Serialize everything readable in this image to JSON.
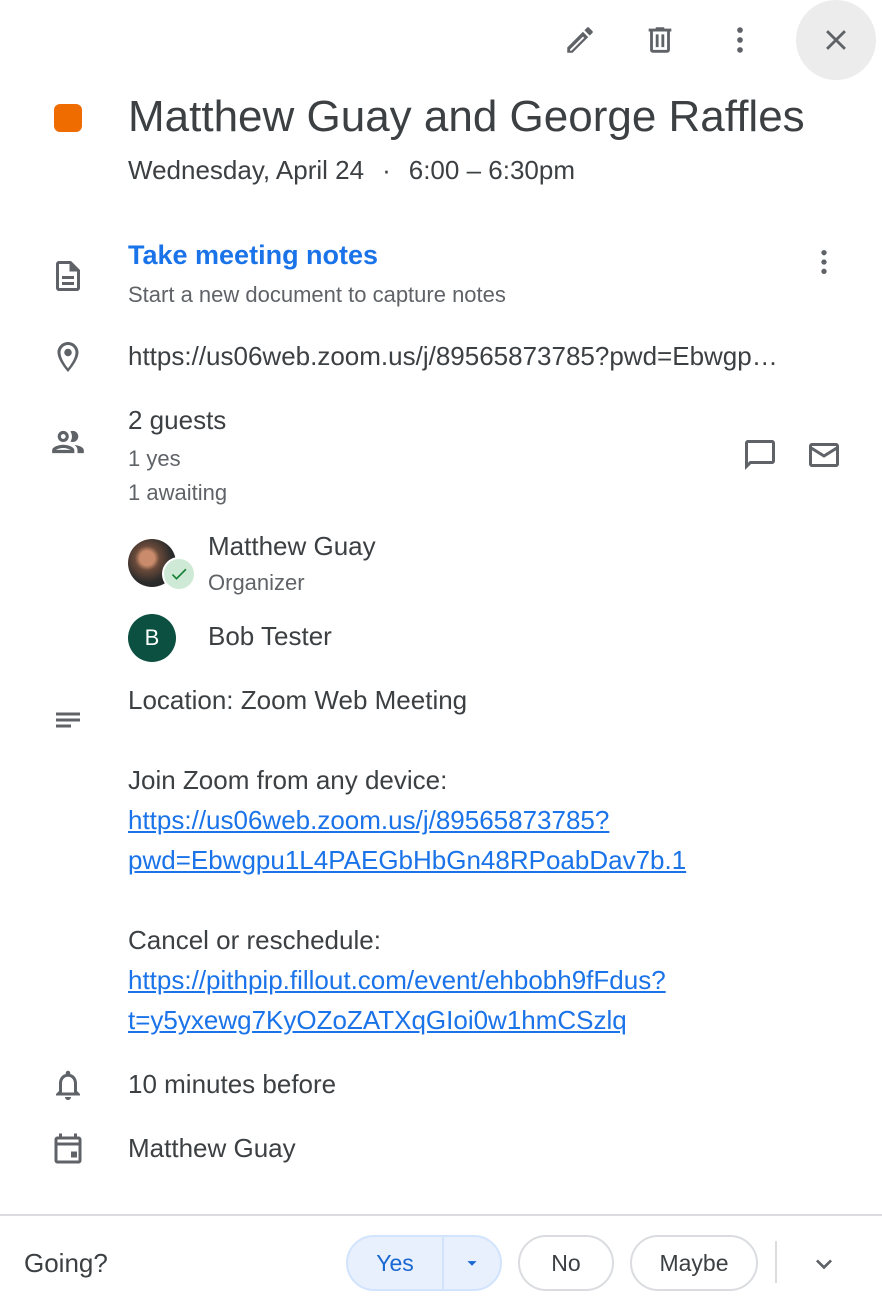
{
  "event": {
    "title": "Matthew Guay and George Raffles",
    "date": "Wednesday, April 24",
    "separator": "·",
    "time": "6:00 – 6:30pm",
    "color": "#ef6c00"
  },
  "notes": {
    "title": "Take meeting notes",
    "subtitle": "Start a new document to capture notes"
  },
  "location": {
    "url": "https://us06web.zoom.us/j/89565873785?pwd=Ebwgp…"
  },
  "guests": {
    "summary": "2 guests",
    "yes": "1 yes",
    "awaiting": "1 awaiting",
    "list": [
      {
        "name": "Matthew Guay",
        "role": "Organizer"
      },
      {
        "name": "Bob Tester",
        "initial": "B"
      }
    ]
  },
  "description": {
    "location_line": "Location: Zoom Web Meeting",
    "join_label": "Join Zoom from any device:",
    "join_link_line1": "https://us06web.zoom.us/j/89565873785?",
    "join_link_line2": "pwd=Ebwgpu1L4PAEGbHbGn48RPoabDav7b.1",
    "cancel_label": "Cancel or reschedule:",
    "cancel_link_line1": "https://pithpip.fillout.com/event/ehbobh9fFdus?",
    "cancel_link_line2": "t=y5yxewg7KyOZoZATXqGIoi0w1hmCSzlq"
  },
  "reminder": {
    "text": "10 minutes before"
  },
  "calendar": {
    "owner": "Matthew Guay"
  },
  "rsvp": {
    "prompt": "Going?",
    "yes": "Yes",
    "no": "No",
    "maybe": "Maybe"
  },
  "colors": {
    "accent": "#1a73e8",
    "yes_bg": "#e8f0fe",
    "avatar_bob": "#0b5040"
  }
}
